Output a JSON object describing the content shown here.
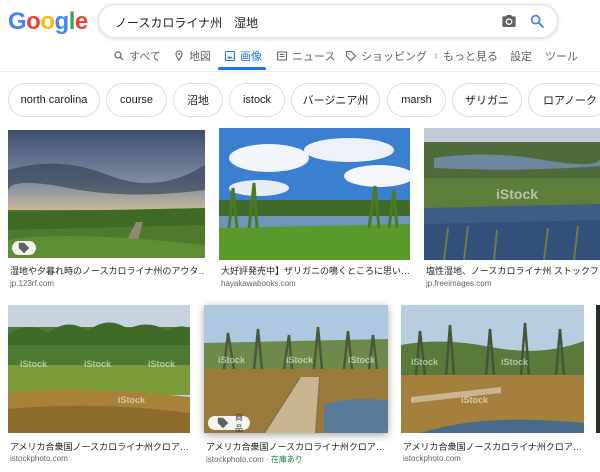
{
  "logo": {
    "letters": [
      "G",
      "o",
      "o",
      "g",
      "l",
      "e"
    ],
    "colors": [
      "#4285f4",
      "#ea4335",
      "#fbbc05",
      "#4285f4",
      "#34a853",
      "#ea4335"
    ]
  },
  "search": {
    "query": "ノースカロライナ州　湿地"
  },
  "tabs": [
    {
      "label": "すべて",
      "icon": "search-icon"
    },
    {
      "label": "地図",
      "icon": "map-pin-icon"
    },
    {
      "label": "画像",
      "icon": "image-icon",
      "active": true
    },
    {
      "label": "ニュース",
      "icon": "news-icon"
    },
    {
      "label": "ショッピング",
      "icon": "tag-icon"
    },
    {
      "label": "もっと見る",
      "icon": "more-dots-icon"
    },
    {
      "label": "設定"
    },
    {
      "label": "ツール"
    }
  ],
  "chips": [
    "north carolina",
    "course",
    "沼地",
    "istock",
    "バージニア州",
    "marsh",
    "ザリガニ",
    "ロアノーク"
  ],
  "results": [
    {
      "title": "湿地や夕暮れ時のノースカロライナ州のアウタ…",
      "source": "jp.123rf.com"
    },
    {
      "title": "大好評発売中】ザリガニの鳴くところに思い…",
      "source": "hayakawabooks.com"
    },
    {
      "title": "塩性湿地、ノースカロライナ州 ストックフォ",
      "source": "jp.freeimages.com"
    },
    {
      "title": "アメリカ合衆国ノースカロライナ州クロア…",
      "source": "istockphoto.com"
    },
    {
      "title": "アメリカ合衆国ノースカロライナ州クロア…",
      "source": "istockphoto.com",
      "stock": "在庫あり",
      "badge": "商品"
    },
    {
      "title": "アメリカ合衆国ノースカロライナ州クロア…",
      "source": "istockphoto.com"
    }
  ],
  "watermark": "iStock",
  "colors": {
    "accent": "#1a73e8",
    "in_stock": "#188038"
  }
}
